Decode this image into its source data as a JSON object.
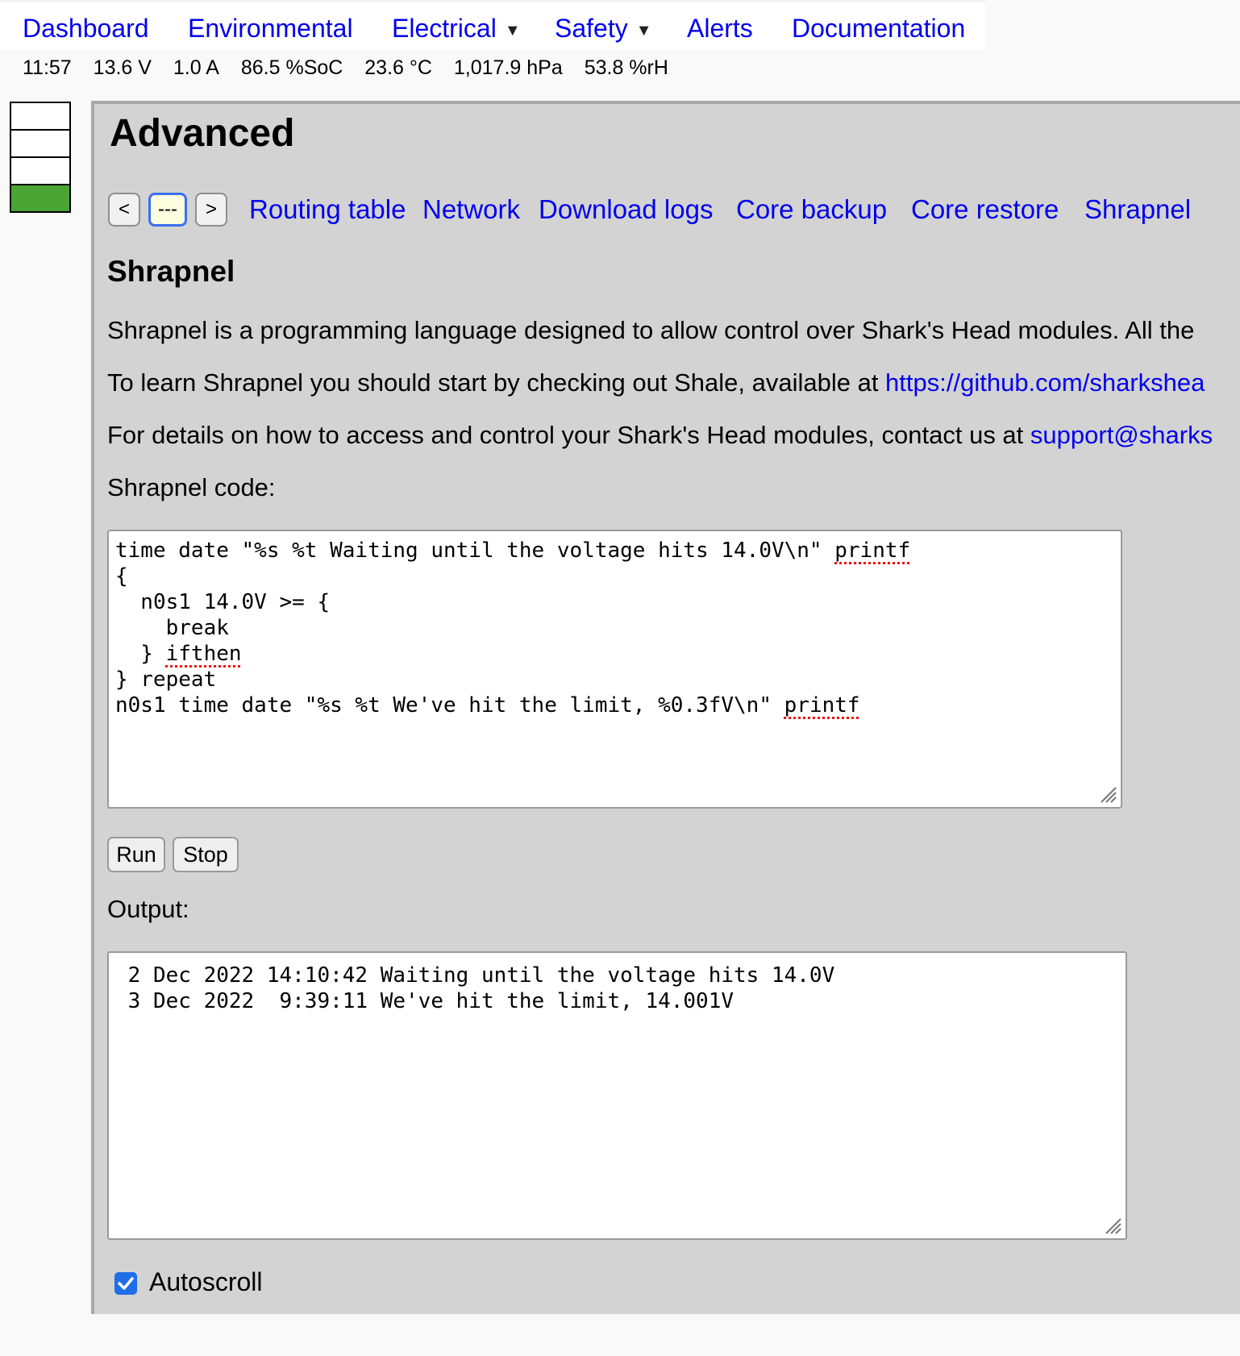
{
  "nav": {
    "items": [
      {
        "label": "Dashboard"
      },
      {
        "label": "Environmental"
      },
      {
        "label": "Electrical",
        "dropdown": true
      },
      {
        "label": "Safety",
        "dropdown": true
      },
      {
        "label": "Alerts"
      },
      {
        "label": "Documentation"
      }
    ]
  },
  "status": {
    "time": "11:57",
    "voltage": "13.6 V",
    "current": "1.0 A",
    "soc": "86.5 %SoC",
    "temperature": "23.6 °C",
    "pressure": "1,017.9 hPa",
    "humidity": "53.8 %rH"
  },
  "battery_meter": {
    "segments": 4,
    "filled_segments": 1,
    "fill_color": "#4aa534"
  },
  "page": {
    "title": "Advanced"
  },
  "subnav": {
    "prev_label": "<",
    "current_label": "---",
    "next_label": ">",
    "links": [
      "Routing table",
      "Network",
      "Download logs",
      "Core backup",
      "Core restore",
      "Shrapnel"
    ]
  },
  "section": {
    "title": "Shrapnel",
    "p1": "Shrapnel is a programming language designed to allow control over Shark's Head modules. All the",
    "p2_text": "To learn Shrapnel you should start by checking out Shale, available at ",
    "p2_link": "https://github.com/sharkshea",
    "p3_text": "For details on how to access and control your Shark's Head modules, contact us at ",
    "p3_link": "support@sharks"
  },
  "code": {
    "label": "Shrapnel code:",
    "line1a": "time date \"%s %t Waiting until the voltage hits 14.0V\\n\" ",
    "line1b": "printf",
    "line2": "{",
    "line3": "  n0s1 14.0V >= {",
    "line4": "    break",
    "line5a": "  } ",
    "line5b": "ifthen",
    "line6": "} repeat",
    "line7a": "n0s1 time date \"%s %t We've hit the limit, %0.3fV\\n\" ",
    "line7b": "printf"
  },
  "buttons": {
    "run": "Run",
    "stop": "Stop"
  },
  "output": {
    "label": "Output:",
    "lines": [
      " 2 Dec 2022 14:10:42 Waiting until the voltage hits 14.0V",
      " 3 Dec 2022  9:39:11 We've hit the limit, 14.001V"
    ]
  },
  "autoscroll": {
    "label": "Autoscroll",
    "checked": true
  },
  "colors": {
    "link": "#0000ee",
    "panel": "#d3d3d3",
    "accent": "#1f6ee8"
  }
}
